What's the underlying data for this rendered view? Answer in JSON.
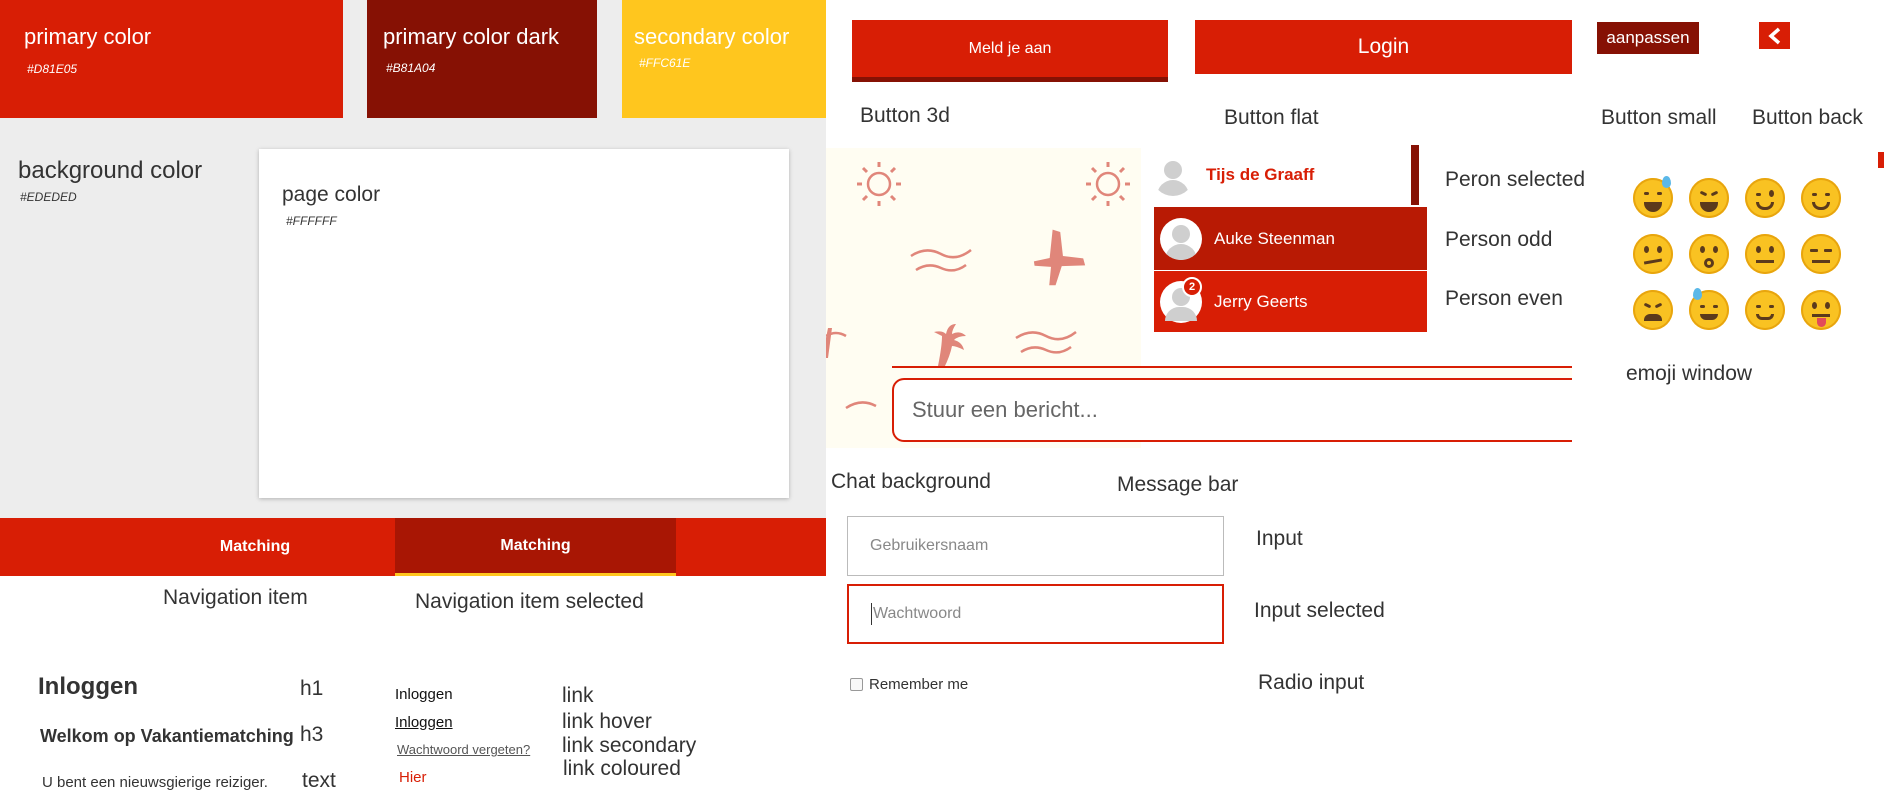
{
  "colors": {
    "primary": {
      "name": "primary color",
      "hex": "#D81E05"
    },
    "primary_dark": {
      "name": "primary color dark",
      "hex": "#B81A04"
    },
    "secondary": {
      "name": "secondary color",
      "hex": "#FFC61E"
    },
    "background": {
      "name": "background color",
      "hex": "#EDEDED"
    },
    "page": {
      "name": "page color",
      "hex": "#FFFFFF"
    }
  },
  "navigation": {
    "item": "Matching",
    "item_selected": "Matching",
    "label_item": "Navigation item",
    "label_selected": "Navigation item selected"
  },
  "typography": {
    "h1": "Inloggen",
    "h1_label": "h1",
    "h3": "Welkom op Vakantiematching",
    "h3_label": "h3",
    "text": "U bent een nieuwsgierige reiziger.",
    "text_label": "text"
  },
  "links": {
    "link": "Inloggen",
    "link_label": "link",
    "hover": "Inloggen",
    "hover_label": "link hover",
    "secondary": "Wachtwoord vergeten?",
    "secondary_label": "link secondary",
    "coloured": "Hier",
    "coloured_label": "link coloured"
  },
  "buttons": {
    "btn3d": "Meld je aan",
    "btn3d_label": "Button 3d",
    "flat": "Login",
    "flat_label": "Button flat",
    "small": "aanpassen",
    "small_label": "Button small",
    "back_label": "Button back"
  },
  "persons": {
    "selected": {
      "name": "Tijs de Graaff",
      "label": "Peron selected"
    },
    "odd": {
      "name": "Auke Steenman",
      "label": "Person odd"
    },
    "even": {
      "name": "Jerry Geerts",
      "label": "Person even",
      "badge": "2"
    }
  },
  "emoji": {
    "label": "emoji window"
  },
  "chat": {
    "label": "Chat background",
    "message_placeholder": "Stuur een bericht...",
    "message_label": "Message bar"
  },
  "inputs": {
    "username_placeholder": "Gebruikersnaam",
    "input_label": "Input",
    "password_placeholder": "Wachtwoord",
    "input_selected_label": "Input selected",
    "remember": "Remember me",
    "radio_label": "Radio input"
  }
}
